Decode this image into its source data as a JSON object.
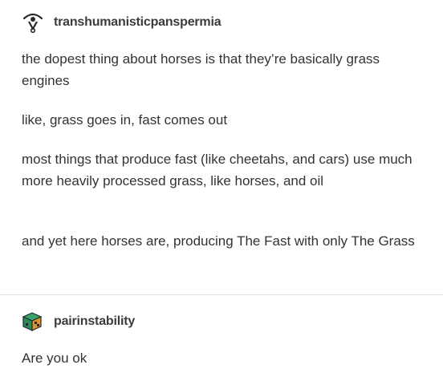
{
  "original_post": {
    "author": "transhumanisticpanspermia",
    "avatar_icon": "eye-sigil-icon",
    "paragraphs": [
      "the dopest thing about horses is that they’re basically grass engines",
      "like, grass goes in, fast comes out",
      "most things that produce fast (like cheetahs, and cars) use much more heavily processed grass, like horses, and oil",
      "and yet here horses are, producing The Fast with only The Grass"
    ]
  },
  "reply": {
    "author": "pairinstability",
    "avatar_icon": "cube-icon",
    "text": "Are you ok"
  },
  "colors": {
    "text": "#333333",
    "divider": "#e2e2e2",
    "cube_green": "#2f8a5a",
    "cube_orange": "#e0922f",
    "cube_dark": "#1f2a2a"
  }
}
